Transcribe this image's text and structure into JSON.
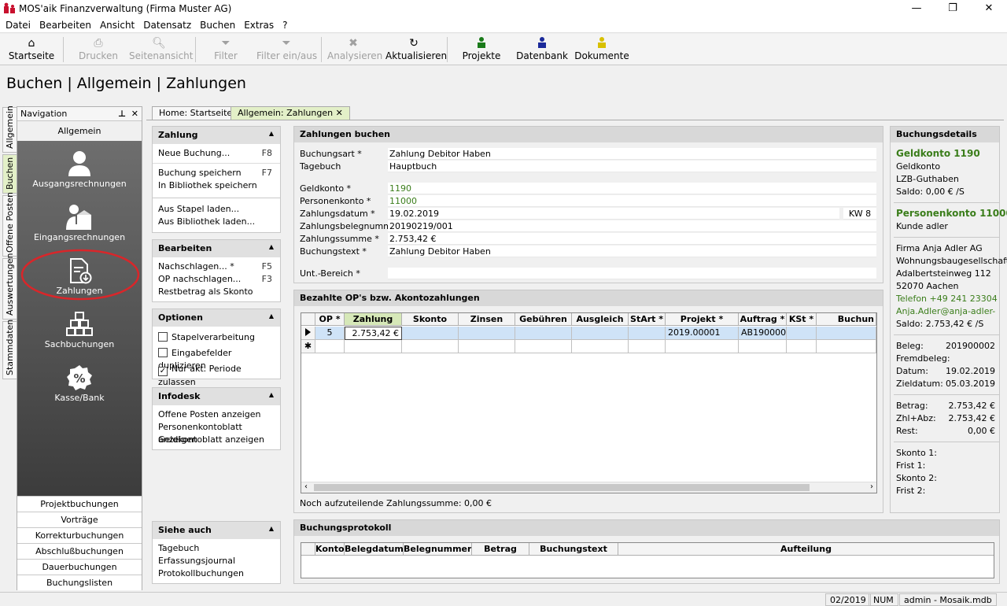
{
  "window": {
    "title": "MOS'aik Finanzverwaltung (Firma Muster AG)",
    "minimize": "—",
    "restore": "❐",
    "close": "✕"
  },
  "menu": [
    "Datei",
    "Bearbeiten",
    "Ansicht",
    "Datensatz",
    "Buchen",
    "Extras",
    "?"
  ],
  "toolbar": {
    "startseite": "Startseite",
    "drucken": "Drucken",
    "seitenansicht": "Seitenansicht",
    "filter": "Filter",
    "filter_toggle": "Filter ein/aus",
    "analysieren": "Analysieren",
    "aktualisieren": "Aktualisieren",
    "projekte": "Projekte",
    "datenbank": "Datenbank",
    "dokumente": "Dokumente"
  },
  "page_title": "Buchen | Allgemein | Zahlungen",
  "side_tabs": [
    "Allgemein",
    "Buchen",
    "Offene Posten",
    "Auswertungen",
    "Stammdaten"
  ],
  "navigation": {
    "title": "Navigation",
    "pin": "⊥",
    "close": "✕",
    "group": "Allgemein",
    "items": [
      "Ausgangsrechnungen",
      "Eingangsrechnungen",
      "Zahlungen",
      "Sachbuchungen",
      "Kasse/Bank"
    ],
    "links": [
      "Projektbuchungen",
      "Vorträge",
      "Korrekturbuchungen",
      "Abschlußbuchungen",
      "Dauerbuchungen",
      "Buchungslisten"
    ]
  },
  "doc_tabs": {
    "home": "Home: Startseite",
    "zahlungen": "Allgemein: Zahlungen",
    "close": "✕"
  },
  "panels": {
    "zahlung": {
      "title": "Zahlung",
      "neue_buchung": "Neue Buchung...",
      "neue_key": "F8",
      "speichern": "Buchung speichern",
      "speichern_key": "F7",
      "bibliothek_speichern": "In Bibliothek speichern",
      "stapel_laden": "Aus Stapel laden...",
      "bibliothek_laden": "Aus Bibliothek laden..."
    },
    "bearbeiten": {
      "title": "Bearbeiten",
      "nachschlagen": "Nachschlagen... *",
      "nachschlagen_key": "F5",
      "op_nachschlagen": "OP nachschlagen...",
      "op_key": "F3",
      "restbetrag": "Restbetrag als Skonto"
    },
    "optionen": {
      "title": "Optionen",
      "opt1": "Stapelverarbeitung",
      "opt2": "Eingabefelder duplizieren",
      "opt3": "Nur akt. Periode zulassen",
      "checkmark": "✓"
    },
    "infodesk": {
      "title": "Infodesk",
      "l1": "Offene Posten anzeigen",
      "l2": "Personenkontoblatt anzeigen",
      "l3": "Geldkontoblatt anzeigen"
    },
    "siehe_auch": {
      "title": "Siehe auch",
      "l1": "Tagebuch",
      "l2": "Erfassungsjournal",
      "l3": "Protokollbuchungen"
    }
  },
  "form": {
    "title": "Zahlungen buchen",
    "buchungsart": {
      "label": "Buchungsart *",
      "value": "Zahlung Debitor Haben"
    },
    "tagebuch": {
      "label": "Tagebuch",
      "value": "Hauptbuch"
    },
    "geldkonto": {
      "label": "Geldkonto *",
      "value": "1190"
    },
    "personenkonto": {
      "label": "Personenkonto *",
      "value": "11000"
    },
    "zahlungsdatum": {
      "label": "Zahlungsdatum *",
      "value": "19.02.2019",
      "kw": "KW 8"
    },
    "belegnummer": {
      "label": "Zahlungsbelegnummer",
      "value": "20190219/001"
    },
    "summe": {
      "label": "Zahlungssumme *",
      "value": "2.753,42 €"
    },
    "buchungstext": {
      "label": "Buchungstext *",
      "value": "Zahlung Debitor Haben"
    },
    "unt_bereich": {
      "label": "Unt.-Bereich *",
      "value": ""
    }
  },
  "op_grid": {
    "title": "Bezahlte OP's bzw. Akontozahlungen",
    "columns": [
      "OP *",
      "Zahlung",
      "Skonto",
      "Zinsen",
      "Gebühren",
      "Ausgleich",
      "StArt *",
      "Projekt *",
      "Auftrag *",
      "KSt *",
      "Buchun"
    ],
    "rows": [
      [
        "5",
        "2.753,42 €",
        "",
        "",
        "",
        "",
        "",
        "2019.00001",
        "AB1900001",
        "",
        ""
      ]
    ],
    "new_row_marker": "✱",
    "footer": "Noch aufzuteilende Zahlungssumme: 0,00 €"
  },
  "protokoll": {
    "title": "Buchungsprotokoll",
    "columns": [
      "Konto",
      "Belegdatum",
      "Belegnummer",
      "Betrag",
      "Buchungstext",
      "Aufteilung"
    ]
  },
  "details": {
    "title": "Buchungsdetails",
    "geldkonto_head": "Geldkonto 1190",
    "geldkonto_name": "Geldkonto",
    "geldkonto_sub": "LZB-Guthaben",
    "geldkonto_saldo": "Saldo: 0,00 € /S",
    "person_head": "Personenkonto 11000",
    "person_name": "Kunde adler",
    "addr1": "Firma Anja Adler AG",
    "addr2": "Wohnungsbaugesellschaft",
    "addr3": "Adalbertsteinweg 112",
    "addr4": "52070 Aachen",
    "telefon": "Telefon +49 241 23304",
    "email": "Anja.Adler@anja-adler-...",
    "person_saldo": "Saldo: 2.753,42 € /S",
    "beleg": {
      "label": "Beleg:",
      "value": "201900002"
    },
    "fremdbeleg": {
      "label": "Fremdbeleg:",
      "value": ""
    },
    "datum": {
      "label": "Datum:",
      "value": "19.02.2019"
    },
    "zieldatum": {
      "label": "Zieldatum:",
      "value": "05.03.2019"
    },
    "betrag": {
      "label": "Betrag:",
      "value": "2.753,42 €"
    },
    "zhl": {
      "label": "Zhl+Abz:",
      "value": "2.753,42 €"
    },
    "rest": {
      "label": "Rest:",
      "value": "0,00 €"
    },
    "skonto1": "Skonto 1:",
    "frist1": "Frist 1:",
    "skonto2": "Skonto 2:",
    "frist2": "Frist 2:"
  },
  "status": {
    "periode": "02/2019",
    "num": "NUM",
    "user": "admin - Mosaik.mdb"
  },
  "colors": {
    "accent_green": "#3a7d1a",
    "tab_active": "#e3f0c8",
    "grid_selected": "#cfe3f7",
    "highlight_circle": "#d9262a"
  }
}
